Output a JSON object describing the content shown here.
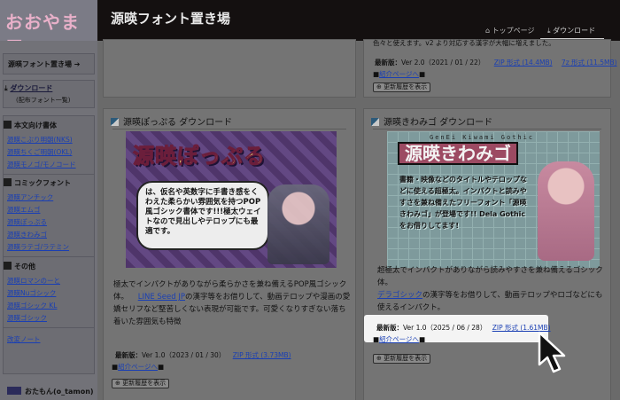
{
  "header": {
    "logo_text": "おおやま屋",
    "site_title": "源暎フォント置き場",
    "nav": [
      {
        "label": "トップページ"
      },
      {
        "label": "ダウンロード"
      }
    ]
  },
  "sidebar": {
    "home_label": "源暎フォント置き場",
    "download_label": "ダウンロード",
    "download_sub": "(配布フォント一覧)",
    "sections": [
      {
        "label": "本文向け書体",
        "items": [
          "源暎こぶり明朝(NKS)",
          "源暎ちくご明朝(OKL)",
          "源暎モノゴ/モノコード"
        ]
      },
      {
        "label": "コミックフォント",
        "items": [
          "源暎アンチック",
          "源暎エムゴ",
          "源暎ぽっぷる",
          "源暎きわみゴ",
          "源暎ラテゴ/ラテミン"
        ]
      },
      {
        "label": "その他",
        "items": [
          "源暎ロマンのーと",
          "源暎Nuゴシック",
          "源暎ゴシック KL",
          "源暎ゴシック"
        ]
      }
    ],
    "changelog": "改変ノート",
    "author": "おたもん(o_tamon)"
  },
  "top_fragment": {
    "text": "色々と使えます。v2 より対応する漢字が大幅に増えました。",
    "version_label": "最新版：",
    "version": "Ver 2.0（2021 / 01 / 22）",
    "zip_link": "ZIP 形式 (14.4MB)",
    "zip7_link": "7z 形式 (11.5MB)",
    "intro_link": "紹介ページへ",
    "history_btn": "更新履歴を表示"
  },
  "cards": [
    {
      "title": "源暎ぽっぷる ダウンロード",
      "banner": {
        "title": "源暎ぽっぷる",
        "text": "は、仮名や英数字に手書き感をくわえた柔らかい雰囲気を持つPOP風ゴシック書体です!!!極太ウェイトなので見出しやテロップにも最適です。"
      },
      "description": "極太でインパクトがありながら柔らかさを兼ね備えるPOP風ゴシック体。",
      "desc_link": "LINE Seed JP",
      "desc_rest": "の漢字等をお借りして、動画テロップや漫画の愛嬌セリフなど堅苦しくない表現が可能です。可愛くなりすぎない落ち着いた雰囲気も特徴",
      "version_label": "最新版：",
      "version": "Ver 1.0（2023 / 01 / 30）",
      "zip_link": "ZIP 形式 (3.73MB)",
      "intro_link": "紹介ページへ",
      "history_btn": "更新履歴を表示"
    },
    {
      "title": "源暎きわみゴ ダウンロード",
      "banner": {
        "subtitle": "GenEi Kiwami Gothic",
        "title": "源暎きわみゴ",
        "text": "書籍・映像などのタイトルやテロップなどに使える超極太。インパクトと読みやすさを兼ね備えたフリーフォント「源暎きわみゴ」が登場です!! Dela Gothicをお借りしてます!"
      },
      "description": "超極太でインパクトがありながら読みやすさを兼ね備えるゴシック体。",
      "desc_link": "デラゴシック",
      "desc_rest": "の漢字等をお借りして、動画テロップやロゴなどにも使えるインパクト。",
      "version_label": "最新版：",
      "version": "Ver 1.0（2025 / 06 / 28）",
      "zip_link": "ZIP 形式 (1.61MB)",
      "intro_link": "紹介ページへ",
      "history_btn": "更新履歴を表示"
    }
  ]
}
